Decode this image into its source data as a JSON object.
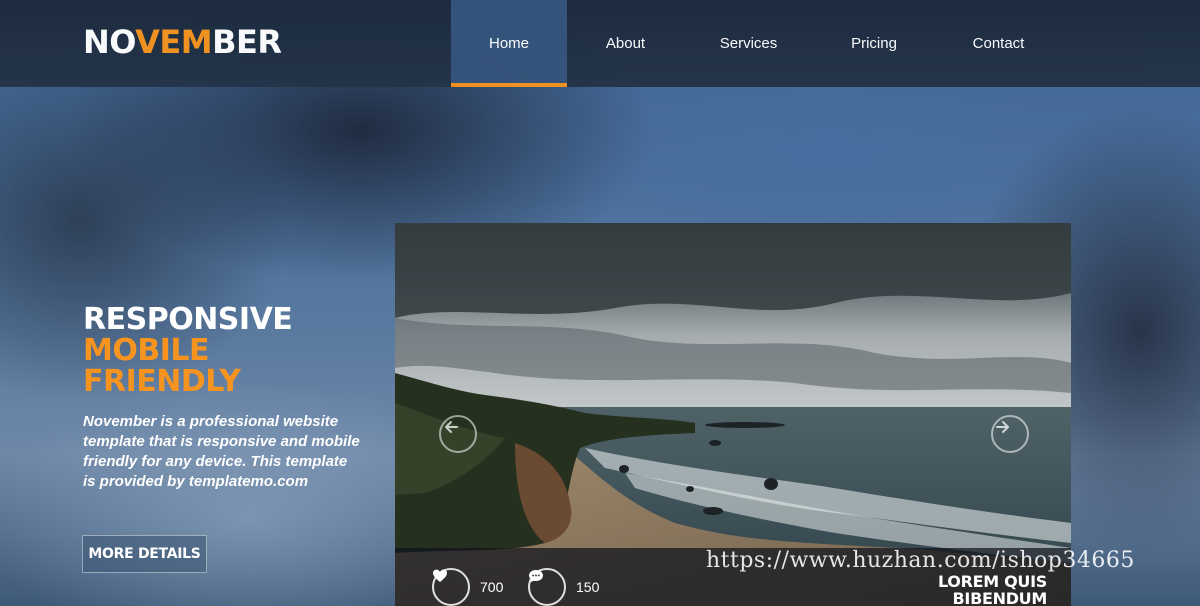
{
  "header": {
    "logo": {
      "part1": "NO",
      "part2": "VEM",
      "part3": "BER"
    },
    "nav": [
      {
        "label": "Home",
        "active": true
      },
      {
        "label": "About",
        "active": false
      },
      {
        "label": "Services",
        "active": false
      },
      {
        "label": "Pricing",
        "active": false
      },
      {
        "label": "Contact",
        "active": false
      }
    ]
  },
  "hero": {
    "title_line1": "RESPONSIVE",
    "title_line2": "MOBILE",
    "title_line3": "FRIENDLY",
    "description": "November is a professional website template that is responsive and mobile friendly for any device. This template is provided by templatemo.com",
    "button_label": "MORE DETAILS"
  },
  "slider": {
    "likes": "700",
    "comments": "150",
    "caption": "LOREM QUIS BIBENDUM"
  },
  "watermark": "https://www.huzhan.com/ishop34665",
  "colors": {
    "accent": "#f6941f",
    "header_bg": "#1c2a3d",
    "nav_active_bg": "#35547b"
  },
  "icons": {
    "prev": "arrow-left-icon",
    "next": "arrow-right-icon",
    "likes": "heart-icon",
    "comments": "chat-bubble-icon"
  }
}
